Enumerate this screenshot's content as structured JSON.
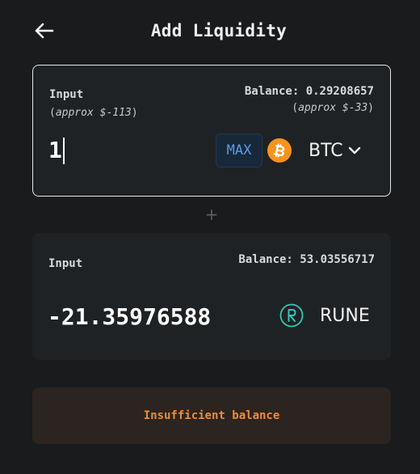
{
  "header": {
    "title": "Add Liquidity"
  },
  "input_1": {
    "label": "Input",
    "approx_prefix": "(",
    "approx_value": "approx $-113",
    "approx_suffix": ")",
    "balance": "Balance: 0.29208657",
    "balance_approx_prefix": "(",
    "balance_approx_value": "approx $-33",
    "balance_approx_suffix": ")",
    "amount": "1",
    "max_label": "MAX",
    "token_symbol": "BTC",
    "token_icon": "bitcoin-icon",
    "token_color": "#f7931a"
  },
  "separator": "+",
  "input_2": {
    "label": "Input",
    "balance": "Balance: 53.03556717",
    "amount": "-21.35976588",
    "token_symbol": "RUNE",
    "token_icon": "rune-icon",
    "token_color": "#33c7b8"
  },
  "status": {
    "message": "Insufficient balance",
    "color": "#f08c34"
  }
}
